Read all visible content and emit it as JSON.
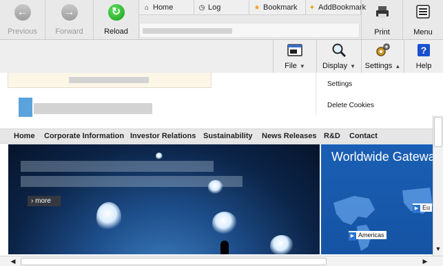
{
  "toolbar": {
    "previous_label": "Previous",
    "forward_label": "Forward",
    "reload_label": "Reload",
    "print_label": "Print",
    "menu_label": "Menu",
    "quick_links": [
      {
        "label": "Home",
        "icon": "house-icon"
      },
      {
        "label": "Log",
        "icon": "clock-icon"
      },
      {
        "label": "Bookmark",
        "icon": "star-icon"
      },
      {
        "label": "AddBookmark",
        "icon": "star-plus-icon"
      }
    ]
  },
  "menubar": {
    "file_label": "File",
    "display_label": "Display",
    "settings_label": "Settings",
    "help_label": "Help"
  },
  "settings_menu": {
    "items": [
      "Settings",
      "Delete Cookies"
    ]
  },
  "site": {
    "nav": [
      "Home",
      "Corporate Information",
      "Investor Relations",
      "Sustainability",
      "News Releases",
      "R&D",
      "Contact"
    ],
    "hero_more_label": "› more",
    "gateway_title": "Worldwide Gateway",
    "regions": [
      "Americas",
      "Eu"
    ]
  },
  "colors": {
    "reload_green": "#2db52d",
    "gateway_blue": "#1a5fb4",
    "logo_blue": "#5aa3dd",
    "help_blue": "#1a4fd0"
  }
}
